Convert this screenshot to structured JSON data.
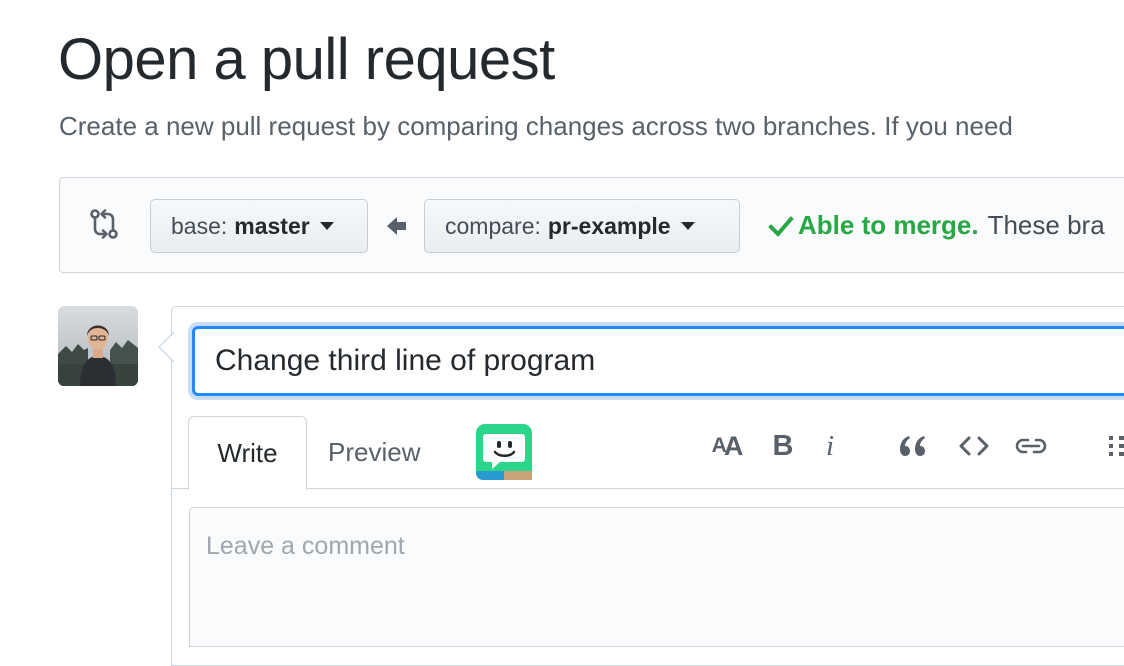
{
  "page": {
    "title": "Open a pull request",
    "subtitle": "Create a new pull request by comparing changes across two branches. If you need"
  },
  "range": {
    "compare_icon": "git-compare-icon",
    "base": {
      "label": "base:",
      "value": "master"
    },
    "arrow_icon": "arrow-left-icon",
    "compare": {
      "label": "compare:",
      "value": "pr-example"
    },
    "merge_status": {
      "icon": "check-icon",
      "ok_text": "Able to merge.",
      "note": "These bra"
    }
  },
  "form": {
    "title_value": "Change third line of program",
    "tabs": [
      {
        "label": "Write",
        "selected": true
      },
      {
        "label": "Preview",
        "selected": false
      }
    ],
    "toolbar": [
      {
        "name": "heading-icon"
      },
      {
        "name": "bold-icon",
        "glyph": "B"
      },
      {
        "name": "italic-icon",
        "glyph": "i"
      },
      {
        "name": "quote-icon"
      },
      {
        "name": "code-icon"
      },
      {
        "name": "link-icon"
      },
      {
        "name": "list-icon"
      }
    ],
    "extension_icon": "bot-extension-icon",
    "comment_placeholder": "Leave a comment"
  },
  "colors": {
    "accent": "#2188ff",
    "success": "#28a745",
    "extension": "#2bd68a"
  }
}
